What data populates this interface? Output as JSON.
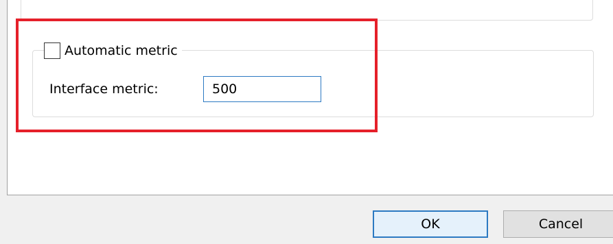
{
  "metric_group": {
    "automatic_metric_label": "Automatic metric",
    "automatic_metric_checked": false,
    "interface_metric_label": "Interface metric:",
    "interface_metric_value": "500"
  },
  "buttons": {
    "ok_label": "OK",
    "cancel_label": "Cancel"
  },
  "colors": {
    "highlight": "#e5202a",
    "focus_border": "#2b79c2"
  }
}
